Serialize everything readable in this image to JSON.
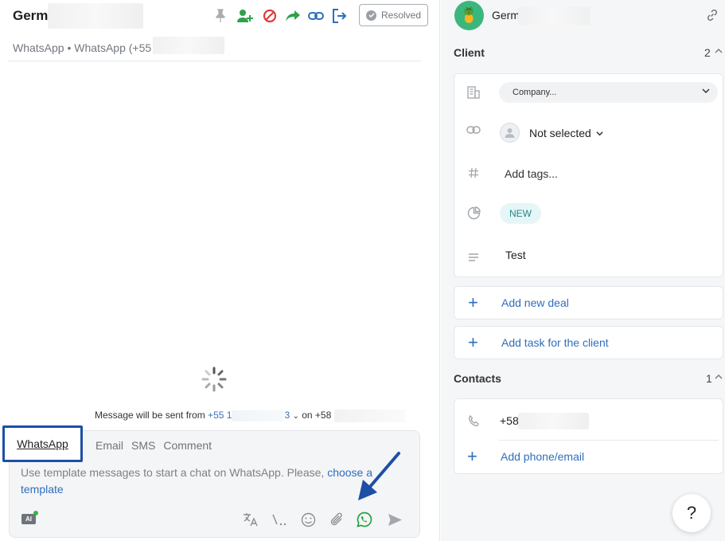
{
  "chat": {
    "contact_name": "Germ",
    "subtitle": "WhatsApp • WhatsApp (+55",
    "resolved_label": "Resolved",
    "send_info": {
      "prefix": "Message will be sent from",
      "from_number": "+55 1",
      "from_suffix": "3",
      "on_label": "on",
      "to_number": "+58"
    },
    "composer": {
      "tabs": [
        "WhatsApp",
        "Email",
        "SMS",
        "Comment"
      ],
      "active_tab": "WhatsApp",
      "hint_text": "Use template messages to start a chat on WhatsApp. Please,",
      "hint_link": "choose a template",
      "ai_badge": "AI"
    },
    "toolbar_icons": [
      "pin-icon",
      "add-user-icon",
      "block-icon",
      "forward-icon",
      "link-icon",
      "exit-icon"
    ],
    "composer_icons": [
      "translate-icon",
      "quick-reply-icon",
      "emoji-icon",
      "attach-icon",
      "whatsapp-icon",
      "send-icon"
    ]
  },
  "sidebar": {
    "contact_name": "Germ",
    "client_section": {
      "title": "Client",
      "count": "2"
    },
    "company_placeholder": "Company...",
    "responsible": "Not selected",
    "tags_placeholder": "Add tags...",
    "status_badge": "NEW",
    "description": "Test",
    "add_deal": "Add new deal",
    "add_task": "Add task for the client",
    "contacts_section": {
      "title": "Contacts",
      "count": "1"
    },
    "phone": "+58",
    "add_phone": "Add phone/email",
    "help_label": "?"
  },
  "colors": {
    "accent_blue": "#2f6ebd",
    "highlight_box": "#1d4fa6",
    "whatsapp_green": "#25a244"
  }
}
